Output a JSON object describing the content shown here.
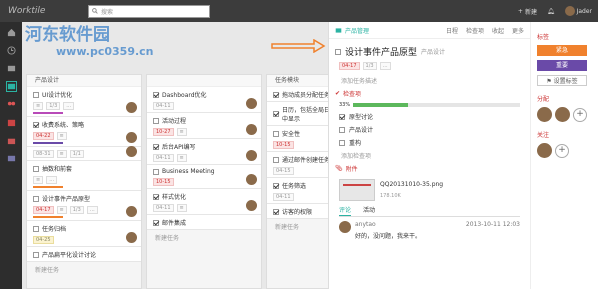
{
  "app": {
    "logo": "Worktile",
    "search_placeholder": "搜索",
    "new_label": "新建",
    "user_name": "Jader"
  },
  "columns": [
    {
      "title": "产品设计",
      "cards": [
        {
          "title": "UI设计优化",
          "checked": false,
          "tags": [
            "≡",
            "1/3",
            "…"
          ],
          "bar": "#b84ab8"
        },
        {
          "title": "收费系统、策略",
          "checked": true,
          "tags": [
            "04-22",
            "≡"
          ],
          "red": 0,
          "bar": "#6a4aa8"
        },
        {
          "title": "",
          "checked": false,
          "tags": [
            "08-31",
            "≡",
            "1/1"
          ],
          "bar": ""
        },
        {
          "title": "抽数和前套",
          "checked": false,
          "tags": [
            "≡",
            "…"
          ],
          "bar": "#f0812d"
        },
        {
          "title": "设计事件产品原型",
          "checked": false,
          "tags": [
            "04-17",
            "≡",
            "1/3",
            "…"
          ],
          "red": 0,
          "bar": "#f0812d"
        },
        {
          "title": "任务归档",
          "checked": false,
          "tags": [
            "04-25"
          ],
          "yellow": 0,
          "bar": ""
        },
        {
          "title": "产品扁平化设计讨论",
          "checked": false,
          "tags": [],
          "bar": ""
        }
      ],
      "new_task": "新建任务"
    },
    {
      "title": "",
      "cards": [
        {
          "title": "Dashboard优化",
          "checked": true,
          "tags": [
            "04-11"
          ],
          "bar": ""
        },
        {
          "title": "活动过程",
          "checked": false,
          "tags": [
            "10-27",
            "≡"
          ],
          "red": 0,
          "bar": ""
        },
        {
          "title": "后台API编写",
          "checked": true,
          "tags": [
            "04-11",
            "≡"
          ],
          "bar": ""
        },
        {
          "title": "Business Meeting",
          "checked": false,
          "tags": [
            "10-15"
          ],
          "red": 0,
          "bar": ""
        },
        {
          "title": "样式优化",
          "checked": true,
          "tags": [
            "04-11",
            "≡"
          ],
          "bar": ""
        },
        {
          "title": "邮件集成",
          "checked": true,
          "tags": [],
          "bar": ""
        }
      ],
      "new_task": "新建任务"
    },
    {
      "title": "任务模块",
      "cards": [
        {
          "title": "拖动成员分配任务",
          "checked": true,
          "tags": [],
          "bar": ""
        },
        {
          "title": "日历，包括全局日历，任务在日历中显示",
          "checked": true,
          "tags": [],
          "bar": ""
        },
        {
          "title": "安全性",
          "checked": false,
          "tags": [
            "10-15"
          ],
          "red": 0,
          "bar": ""
        },
        {
          "title": "通过邮件创建任务",
          "checked": false,
          "tags": [
            "04-15"
          ],
          "bar": ""
        },
        {
          "title": "任务筛选",
          "checked": true,
          "tags": [
            "04-11"
          ],
          "bar": ""
        },
        {
          "title": "访客的权限",
          "checked": true,
          "tags": [],
          "bar": ""
        }
      ],
      "new_task": "新建任务"
    }
  ],
  "panel": {
    "project": "产品管理",
    "actions": [
      "日程",
      "检查项",
      "收起",
      "更多"
    ],
    "title": "设计事件产品原型",
    "subtitle": "产品设计",
    "due": "04-17",
    "meta_extra": [
      "1/3",
      "…"
    ],
    "add_desc": "添加任务描述",
    "checklist_title": "检查项",
    "progress_pct": 33,
    "progress_label": "33%",
    "checklist": [
      {
        "text": "原型讨论",
        "checked": true
      },
      {
        "text": "产品设计",
        "checked": false
      },
      {
        "text": "重构",
        "checked": false
      }
    ],
    "add_checklist": "添加检查项",
    "attach_title": "附件",
    "attach_name": "QQ20131010-35.png",
    "attach_size": "178.10K",
    "tabs": [
      "评论",
      "活动"
    ],
    "comment": {
      "author": "anytao",
      "time": "2013-10-11 12:03",
      "text": "好的，没问题，我来干。"
    }
  },
  "right": {
    "label_title": "标签",
    "labels": [
      "紧急",
      "重要"
    ],
    "set_label": "设置标签",
    "assign_title": "分配",
    "follow_title": "关注"
  },
  "watermark": {
    "line1": "河东软件园",
    "line2": "www.pc0359.cn"
  }
}
